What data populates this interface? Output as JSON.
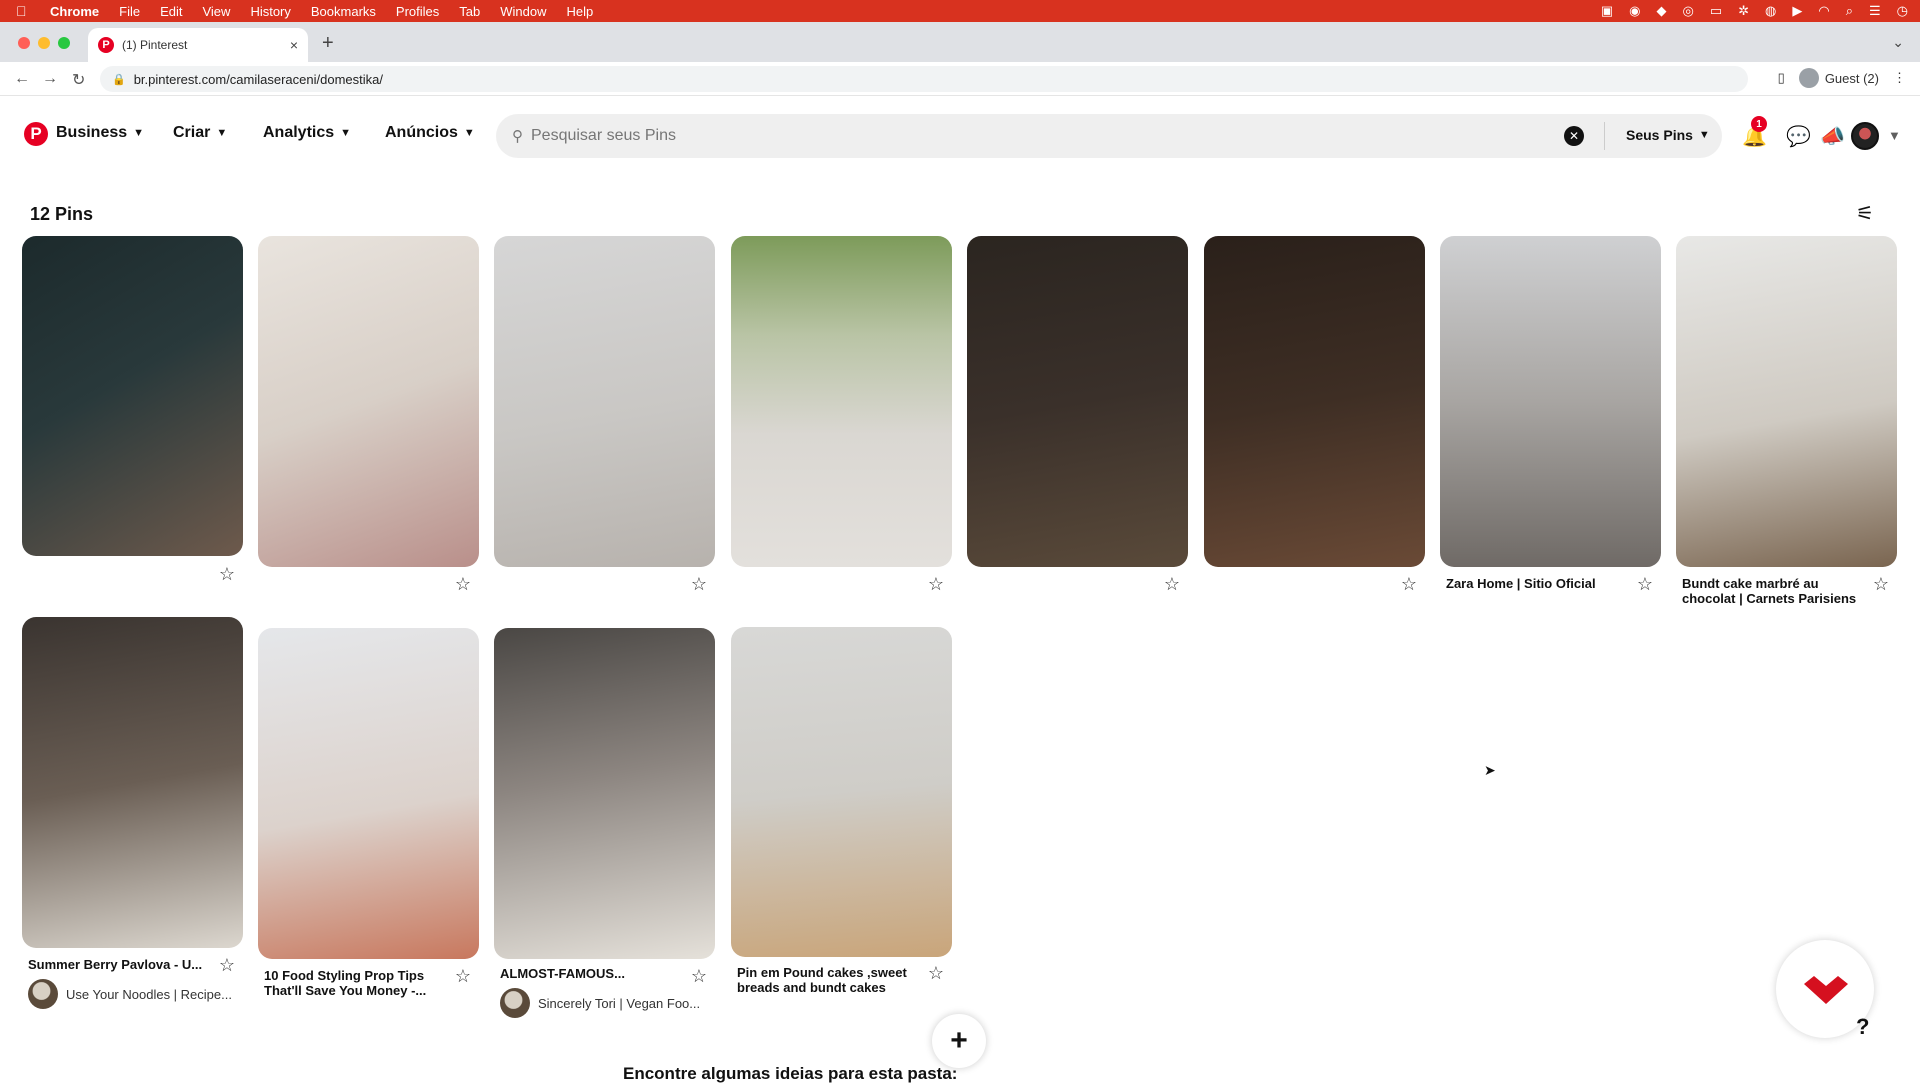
{
  "menubar": {
    "apple": "",
    "app": "Chrome",
    "items": [
      "File",
      "Edit",
      "View",
      "History",
      "Bookmarks",
      "Profiles",
      "Tab",
      "Window",
      "Help"
    ],
    "tray_icons": [
      "text-icon",
      "record-icon",
      "dropbox-icon",
      "cc-icon",
      "display-icon",
      "gear-icon",
      "airdrop-icon",
      "play-icon",
      "wifi-icon",
      "search-icon",
      "control-center-icon",
      "clock-icon"
    ]
  },
  "browser": {
    "tab_title": "(1) Pinterest",
    "tab_close": "×",
    "new_tab": "+",
    "url": "br.pinterest.com/camilaseraceni/domestika/",
    "profile": "Guest (2)"
  },
  "header": {
    "logo": "P",
    "nav": [
      {
        "label": "Business"
      },
      {
        "label": "Criar"
      },
      {
        "label": "Analytics"
      },
      {
        "label": "Anúncios"
      }
    ],
    "search_placeholder": "Pesquisar seus Pins",
    "scope_label": "Seus Pins",
    "notification_count": "1"
  },
  "board": {
    "pin_count": "12 Pins",
    "pins": [
      {
        "title": "",
        "source": "",
        "colors": [
          "#1c2a2c",
          "#6e5a4c"
        ]
      },
      {
        "title": "",
        "source": "",
        "colors": [
          "#e9e4de",
          "#b98f8a"
        ]
      },
      {
        "title": "",
        "source": "",
        "colors": [
          "#d6d6d6",
          "#b7b2ad"
        ]
      },
      {
        "title": "",
        "source": "",
        "colors": [
          "#dad7d2",
          "#7d9b5a"
        ]
      },
      {
        "title": "",
        "source": "",
        "colors": [
          "#2b2520",
          "#5a4a3a"
        ]
      },
      {
        "title": "",
        "source": "",
        "colors": [
          "#2a201a",
          "#6a4a36"
        ]
      },
      {
        "title": "Zara Home | Sitio Oficial",
        "source": "",
        "colors": [
          "#cfd0d2",
          "#6f6a66"
        ]
      },
      {
        "title": "Bundt cake marbré au chocolat | Carnets Parisiens",
        "source": "",
        "colors": [
          "#e8e8e6",
          "#7a6550"
        ]
      },
      {
        "title": "Summer Berry Pavlova - U...",
        "source": "Use Your Noodles | Recipe...",
        "colors": [
          "#3a3430",
          "#dcd7cf"
        ]
      },
      {
        "title": "10 Food Styling Prop Tips That'll Save You Money -...",
        "source": "",
        "colors": [
          "#e5e7ea",
          "#c8785e"
        ]
      },
      {
        "title": "ALMOST-FAMOUS...",
        "source": "Sincerely Tori | Vegan Foo...",
        "colors": [
          "#4a4744",
          "#e5e1da"
        ]
      },
      {
        "title": "Pin em Pound cakes ,sweet breads and bundt cakes",
        "source": "",
        "colors": [
          "#d8d8d6",
          "#c9a57a"
        ]
      }
    ],
    "add_button": "+",
    "suggestions_heading": "Encontre algumas ideias para esta pasta:",
    "help_label": "?"
  }
}
